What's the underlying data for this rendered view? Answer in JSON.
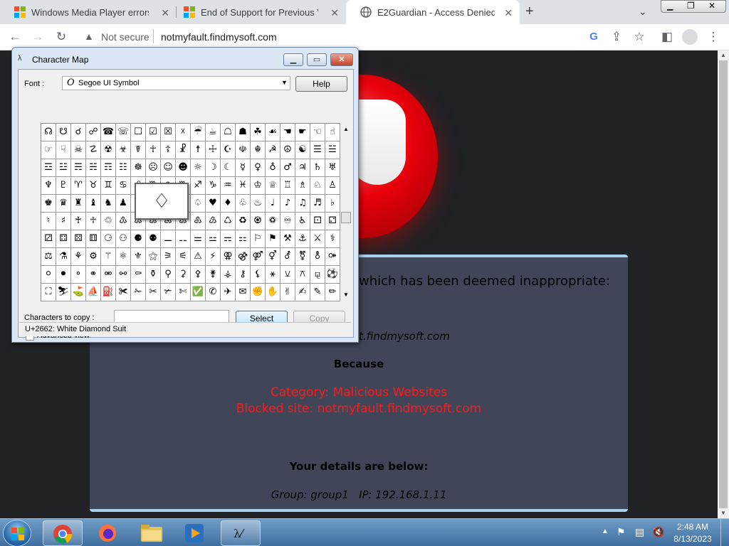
{
  "browser": {
    "tabs": [
      {
        "title": "Windows Media Player errors - Mi",
        "icon": "windows-logo-icon"
      },
      {
        "title": "End of Support for Previous Versi",
        "icon": "windows-logo-icon"
      },
      {
        "title": "E2Guardian - Access Denied",
        "icon": "globe-icon"
      }
    ],
    "new_tab_glyph": "+",
    "security_label": "Not secure",
    "url": "notmyfault.findmysoft.com"
  },
  "page": {
    "heading": "which has been deemed inappropriate:",
    "blocked_url_fragment": "t.findmysoft.com",
    "because": "Because",
    "category": "Category: Malicious Websites",
    "blocked_site": "Blocked site: notmyfault.findmysoft.com",
    "details_heading": "Your details are below:",
    "details": "Group: group1   IP: 192.168.1.11"
  },
  "charmap": {
    "title": "Character Map",
    "font_label": "Font :",
    "font_value": "Segoe UI Symbol",
    "help": "Help",
    "copy_label": "Characters to copy :",
    "copy_value": "",
    "select": "Select",
    "copy": "Copy",
    "advanced": "Advanced view",
    "status": "U+2662: White Diamond Suit",
    "magnified": "♢",
    "rows": [
      "☊☋☌☍☎☏☐☑☒☓☔☕☖☗☘☙☚☛☜☝",
      "☞☟☠☡☢☣☤☥☦☧☨☩☪☫☬☭☮☯☰☱",
      "☲☳☴☵☶☷☸☹☺☻☼☽☾☿♀♁♂♃♄♅",
      "♆♇♈♉♊♋♌♍♎♏♐♑♒♓♔♕♖♗♘♙",
      "♚♛♜♝♞♟♠♡♢♣♤♥♦♧♨♩♪♫♬♭",
      "♮♯♰♱♲♳♴♵♶♷♸♹♺♻♼♽♾♿⚀⚁",
      "⚂⚃⚄⚅⚆⚇⚈⚉⚊⚋⚌⚍⚎⚏⚐⚑⚒⚓⚔⚕",
      "⚖⚗⚘⚙⚚⚛⚜⚝⚞⚟⚠⚡⚢⚣⚤⚥⚦⚧⚨⚩",
      "⚪⚫⚬⚭⚮⚯⚰⚱⚲⚳⚴⚵⚶⚷⚸⚹⚺⚻⚼⚽",
      "⛶⛷⛳⛵⛽✀✁✂✃✄✅✆✈✉✊✋✌✍✎✏"
    ]
  },
  "taskbar": {
    "time": "2:48 AM",
    "date": "8/13/2023"
  }
}
